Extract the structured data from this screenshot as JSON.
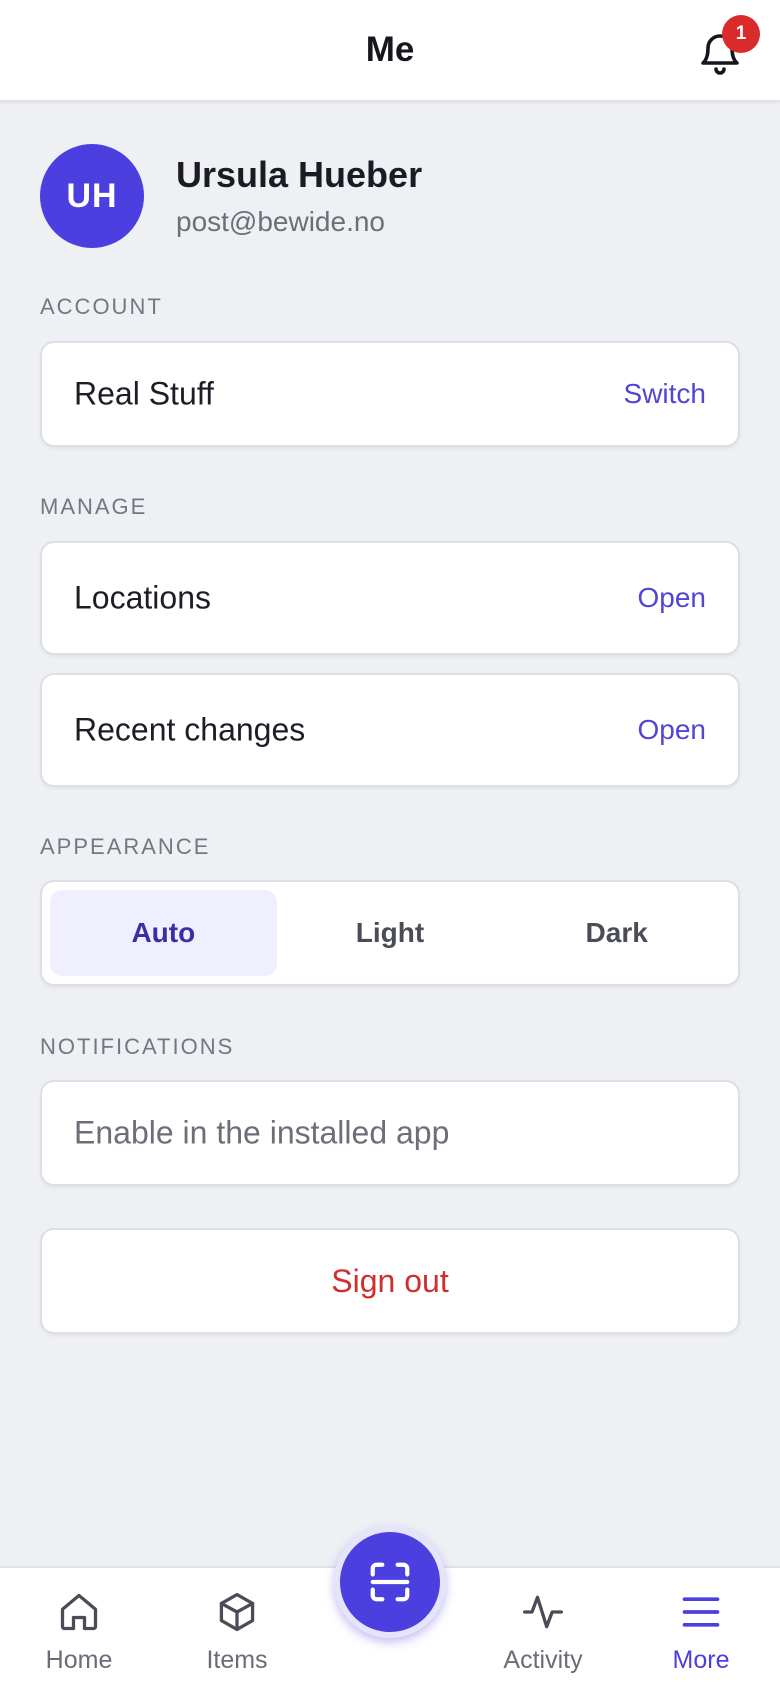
{
  "header": {
    "title": "Me",
    "notification_count": "1"
  },
  "profile": {
    "initials": "UH",
    "name": "Ursula Hueber",
    "email": "post@bewide.no"
  },
  "account": {
    "section_label": "ACCOUNT",
    "name": "Real Stuff",
    "action": "Switch"
  },
  "manage": {
    "section_label": "MANAGE",
    "items": [
      {
        "label": "Locations",
        "action": "Open"
      },
      {
        "label": "Recent changes",
        "action": "Open"
      }
    ]
  },
  "appearance": {
    "section_label": "APPEARANCE",
    "options": [
      "Auto",
      "Light",
      "Dark"
    ],
    "selected": "Auto"
  },
  "notifications": {
    "section_label": "NOTIFICATIONS",
    "text": "Enable in the installed app"
  },
  "sign_out": {
    "label": "Sign out"
  },
  "bottom_nav": {
    "items": [
      {
        "label": "Home",
        "icon": "home-icon"
      },
      {
        "label": "Items",
        "icon": "box-icon"
      },
      {
        "label": "Activity",
        "icon": "activity-icon"
      },
      {
        "label": "More",
        "icon": "menu-icon"
      }
    ],
    "active": "More",
    "scan_icon": "scan-icon"
  },
  "colors": {
    "accent": "#4c3fe0",
    "danger": "#d02f2f",
    "background": "#eef0f4"
  }
}
